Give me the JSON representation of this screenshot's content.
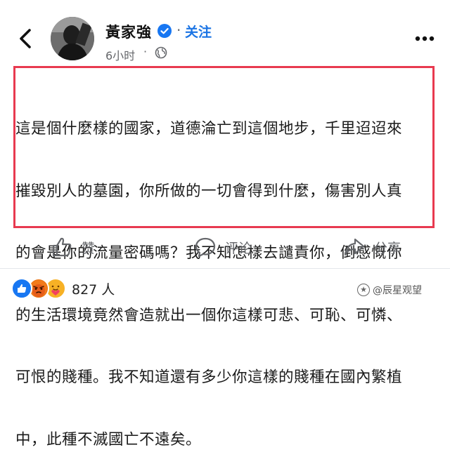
{
  "header": {
    "back_icon": "chevron-left-icon",
    "author_name": "黃家強",
    "verified_icon": "verified-badge-icon",
    "separator": "·",
    "follow_label": "关注",
    "timestamp": "6小时",
    "privacy_icon": "globe-icon",
    "more_icon": "more-dots-icon"
  },
  "post": {
    "lines": [
      "這是個什麼樣的國家，道德淪亡到這個地步，千里迢迢來",
      "摧毀別人的墓園，你所做的一切會得到什麼，傷害別人真",
      "的會是你的流量密碼嗎？我不知怎樣去譴責你，倒感慨你",
      "的生活環境竟然會造就出一個你這樣可悲、可恥、可憐、",
      "可恨的賤種。我不知道還有多少你這樣的賤種在國內繁植",
      "中，此種不滅國亡不遠矣。"
    ],
    "highlight_color": "#e83a50"
  },
  "actions": {
    "like_label": "赞",
    "comment_label": "评论",
    "share_label": "分享"
  },
  "reactions": {
    "icons": [
      "like-reaction-icon",
      "angry-reaction-icon",
      "care-reaction-icon"
    ],
    "count": "827 人"
  },
  "watermark": {
    "text": "@辰星观望"
  },
  "colors": {
    "link_blue": "#1b74e4",
    "muted_gray": "#65676b",
    "highlight_red": "#e83a50",
    "like_blue": "#1877f2",
    "angry_orange": "#e9710f"
  }
}
